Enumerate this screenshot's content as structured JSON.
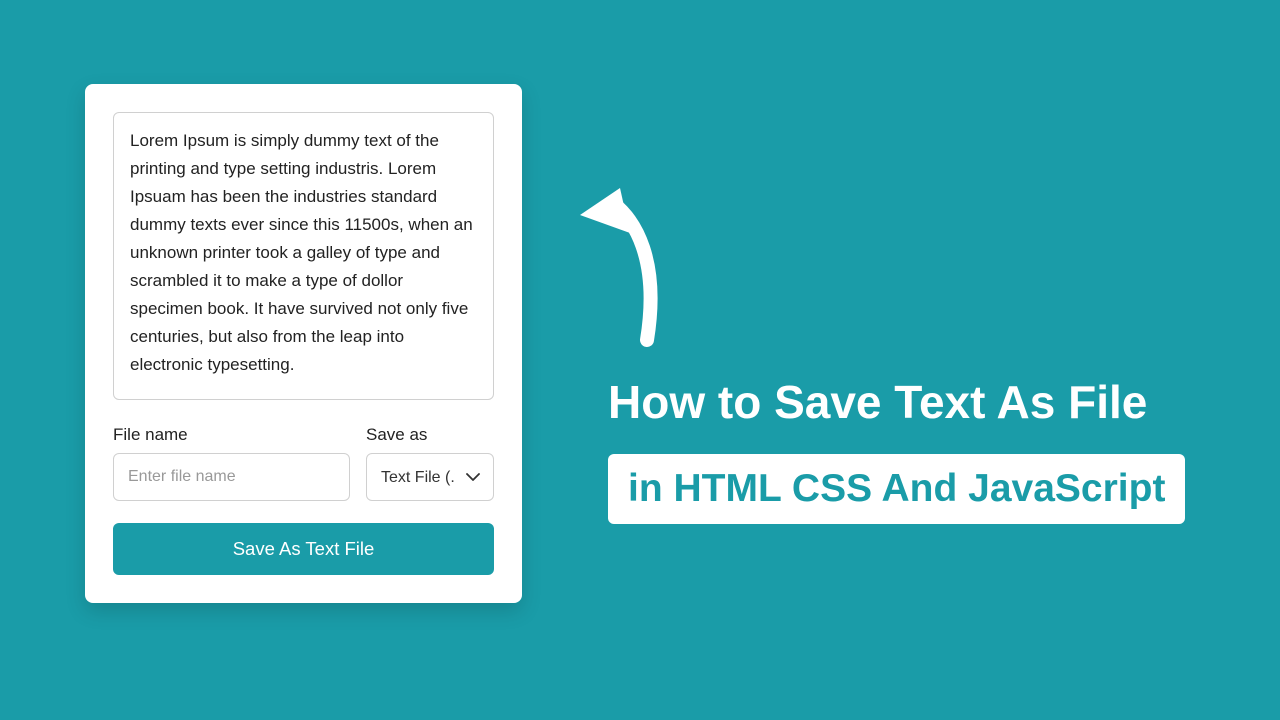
{
  "card": {
    "textarea_value": "Lorem Ipsum is simply dummy text of the printing and type setting industris. Lorem Ipsuam has been the industries standard dummy texts ever since this 11500s, when an unknown printer took a galley of type and scrambled it to make a type of dollor specimen book. It have survived not only five centuries, but also from the leap into electronic typesetting.",
    "filename_label": "File name",
    "filename_placeholder": "Enter file name",
    "filename_value": "",
    "saveas_label": "Save as",
    "saveas_selected": "Text File (.txt)",
    "save_button_label": "Save As Text File"
  },
  "heading": {
    "line1": "How to Save Text As File",
    "badge": "in HTML CSS And JavaScript"
  },
  "colors": {
    "accent": "#1a9ca8",
    "white": "#ffffff"
  }
}
